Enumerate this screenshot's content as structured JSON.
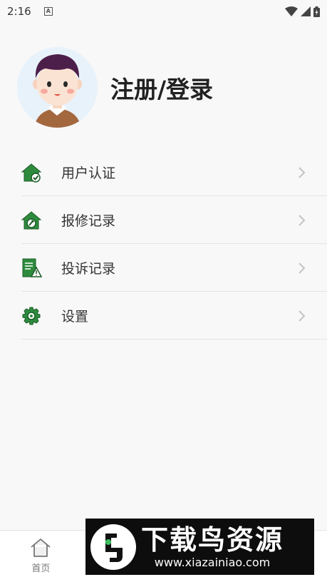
{
  "status_bar": {
    "time": "2:16",
    "notification_badge": "A"
  },
  "profile": {
    "login_label": "注册/登录"
  },
  "menu": {
    "items": [
      {
        "label": "用户认证",
        "icon": "house-check-icon"
      },
      {
        "label": "报修记录",
        "icon": "house-repair-icon"
      },
      {
        "label": "投诉记录",
        "icon": "document-complaint-icon"
      },
      {
        "label": "设置",
        "icon": "gear-icon"
      }
    ]
  },
  "tabbar": {
    "tabs": [
      {
        "label": "首页",
        "icon": "home-icon"
      }
    ]
  },
  "watermark": {
    "title": "下载鸟资源",
    "url": "www.xiazainiao.com"
  },
  "colors": {
    "icon_green": "#2e8b3e",
    "arrow": "#c4c4c4",
    "avatar_bg": "#e8f2fb"
  }
}
